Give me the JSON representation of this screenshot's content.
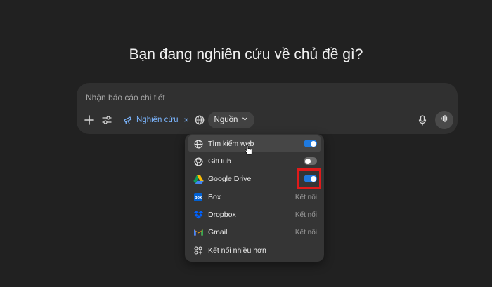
{
  "heading": "Bạn đang nghiên cứu về chủ đề gì?",
  "composer": {
    "placeholder": "Nhận báo cáo chi tiết",
    "research_chip": "Nghiên cứu",
    "research_close": "×",
    "sources_label": "Nguồn"
  },
  "sources_menu": {
    "items": [
      {
        "label": "Tìm kiếm web",
        "icon": "globe-icon",
        "control": "toggle",
        "on": true
      },
      {
        "label": "GitHub",
        "icon": "github-icon",
        "control": "toggle",
        "on": false
      },
      {
        "label": "Google Drive",
        "icon": "google-drive-icon",
        "control": "toggle",
        "on": true
      },
      {
        "label": "Box",
        "icon": "box-icon",
        "control": "text",
        "right": "Kết nối"
      },
      {
        "label": "Dropbox",
        "icon": "dropbox-icon",
        "control": "text",
        "right": "Kết nối"
      },
      {
        "label": "Gmail",
        "icon": "gmail-icon",
        "control": "text",
        "right": "Kết nối"
      },
      {
        "label": "Kết nối nhiều hơn",
        "icon": "apps-icon",
        "control": "none"
      }
    ]
  },
  "colors": {
    "background": "#212121",
    "accent_blue": "#1f7ae0",
    "link_blue": "#7cb6ff",
    "highlight_red": "#e01b1b"
  }
}
